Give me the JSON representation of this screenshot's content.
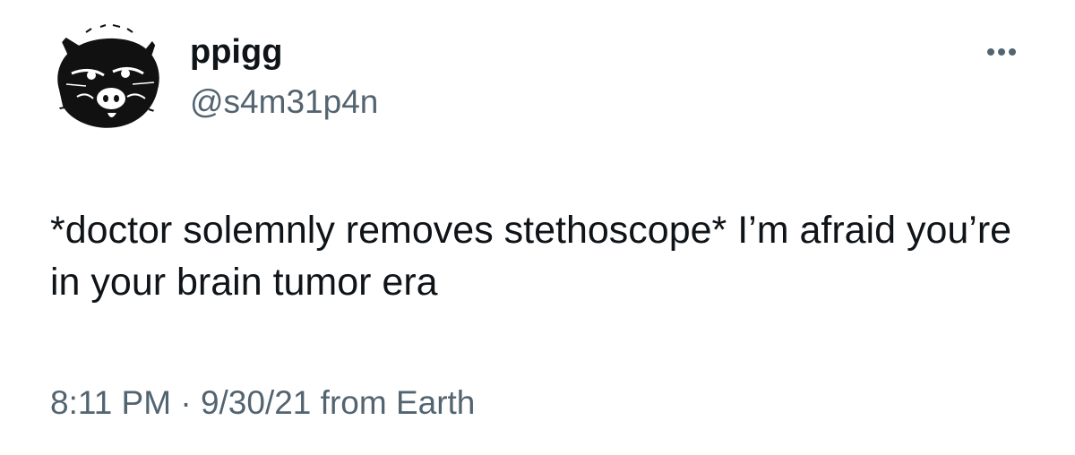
{
  "author": {
    "display_name": "ppigg",
    "handle": "@s4m31p4n"
  },
  "tweet": {
    "text": "*doctor solemnly removes stethoscope* I’m afraid you’re in your brain tumor era"
  },
  "meta": {
    "time": "8:11 PM",
    "separator": "·",
    "date": "9/30/21",
    "source": "from Earth"
  },
  "icons": {
    "more": "more-options-icon",
    "avatar": "pig-drawing-avatar"
  },
  "colors": {
    "text_primary": "#0f1419",
    "text_secondary": "#536471",
    "background": "#ffffff"
  }
}
